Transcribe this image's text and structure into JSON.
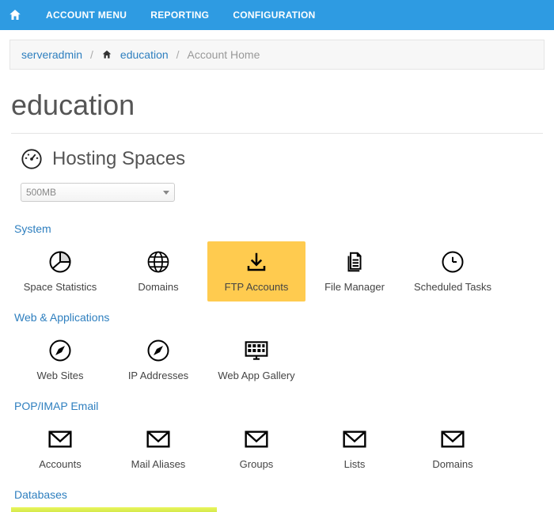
{
  "nav": {
    "items": [
      "ACCOUNT MENU",
      "REPORTING",
      "CONFIGURATION"
    ]
  },
  "breadcrumb": {
    "root": "serveradmin",
    "mid": "education",
    "current": "Account Home"
  },
  "page_title": "education",
  "hosting": {
    "label": "Hosting Spaces",
    "selected": "500MB"
  },
  "sections": [
    {
      "label": "System",
      "tiles": [
        {
          "name": "space-statistics",
          "label": "Space Statistics",
          "icon": "pie"
        },
        {
          "name": "domains",
          "label": "Domains",
          "icon": "globe"
        },
        {
          "name": "ftp-accounts",
          "label": "FTP Accounts",
          "icon": "download",
          "selected": true
        },
        {
          "name": "file-manager",
          "label": "File Manager",
          "icon": "files"
        },
        {
          "name": "scheduled-tasks",
          "label": "Scheduled Tasks",
          "icon": "clock"
        }
      ]
    },
    {
      "label": "Web & Applications",
      "tiles": [
        {
          "name": "web-sites",
          "label": "Web Sites",
          "icon": "compass"
        },
        {
          "name": "ip-addresses",
          "label": "IP Addresses",
          "icon": "compass"
        },
        {
          "name": "web-app-gallery",
          "label": "Web App Gallery",
          "icon": "monitor"
        }
      ]
    },
    {
      "label": "POP/IMAP Email",
      "tiles": [
        {
          "name": "mail-accounts",
          "label": "Accounts",
          "icon": "mail"
        },
        {
          "name": "mail-aliases",
          "label": "Mail Aliases",
          "icon": "mail"
        },
        {
          "name": "mail-groups",
          "label": "Groups",
          "icon": "mail"
        },
        {
          "name": "mail-lists",
          "label": "Lists",
          "icon": "mail"
        },
        {
          "name": "mail-domains",
          "label": "Domains",
          "icon": "mail"
        }
      ]
    },
    {
      "label": "Databases",
      "tiles": []
    }
  ]
}
